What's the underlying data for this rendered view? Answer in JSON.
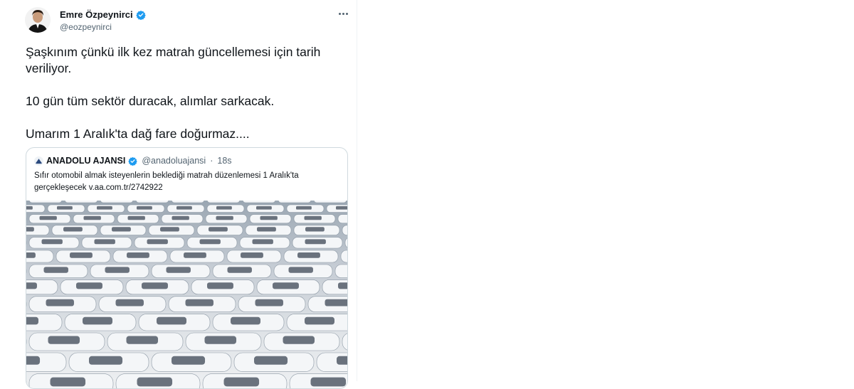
{
  "tweet": {
    "author_name": "Emre Özpeynirci",
    "author_handle": "@eozpeynirci",
    "verified": true,
    "paragraphs": [
      "Şaşkınım çünkü ilk kez matrah güncellemesi için tarih veriliyor.",
      "10 gün tüm sektör duracak, alımlar sarkacak.",
      "Umarım 1 Aralık'ta dağ fare doğurmaz...."
    ]
  },
  "quoted": {
    "author_name": "ANADOLU AJANSI",
    "author_handle": "@anadoluajansi",
    "separator": "·",
    "time": "18s",
    "verified": true,
    "text": "Sıfır otomobil almak isteyenlerin beklediği matrah düzenlemesi 1 Aralık'ta gerçekleşecek v.aa.com.tr/2742922",
    "image_subject": "rows of parked new cars"
  },
  "icons": {
    "verified": "verified-badge-icon",
    "more": "more-dots-icon",
    "logo": "anadolu-logo-icon"
  },
  "colors": {
    "verified": "#1d9bf0",
    "text": "#0f1419",
    "secondary": "#536471",
    "border": "#cfd9de"
  }
}
